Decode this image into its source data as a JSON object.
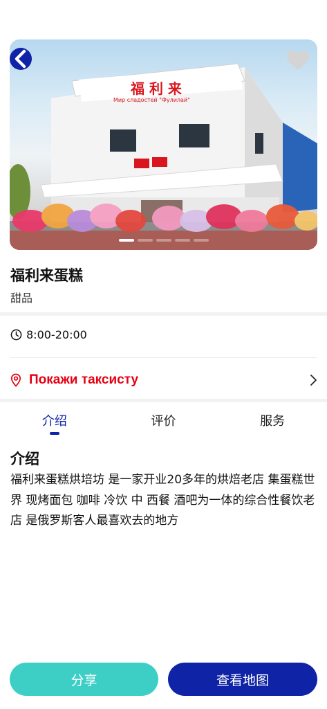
{
  "hero": {
    "image_icon": "storefront-photo",
    "sign_text": "福 利 来",
    "sign_subtext": "Мир сладостей \"Фулилай\"",
    "carousel_dots": 5,
    "carousel_active_index": 0
  },
  "shop": {
    "name": "福利来蛋糕",
    "category": "甜品",
    "hours": "8:00-20:00",
    "taxi_label": "Покажи таксисту"
  },
  "tabs": [
    {
      "label": "介绍",
      "active": true
    },
    {
      "label": "评价",
      "active": false
    },
    {
      "label": "服务",
      "active": false
    }
  ],
  "intro": {
    "title": "介绍",
    "text": "福利来蛋糕烘培坊 是一家开业20多年的烘焙老店 集蛋糕世界 现烤面包 咖啡 冷饮 中 西餐 酒吧为一体的综合性餐饮老店 是俄罗斯客人最喜欢去的地方"
  },
  "actions": {
    "share_label": "分享",
    "map_label": "查看地图"
  },
  "colors": {
    "primary": "#0f23a6",
    "teal": "#3dcfc6",
    "taxi_red": "#e60012"
  }
}
